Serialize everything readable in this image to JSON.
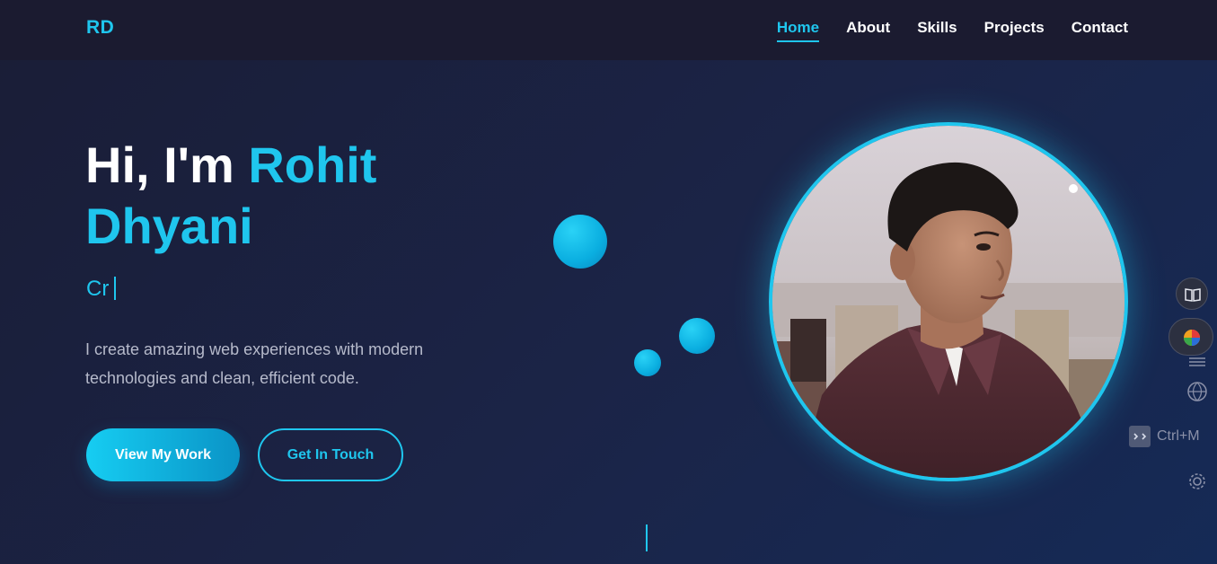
{
  "nav": {
    "logo": "RD",
    "links": [
      "Home",
      "About",
      "Skills",
      "Projects",
      "Contact"
    ],
    "active": "Home"
  },
  "hero": {
    "greeting": "Hi, I'm",
    "first_name": "Rohit",
    "last_name": "Dhyani",
    "typed_text": "Cr",
    "description": "I create amazing web experiences with modern technologies and clean, efficient code.",
    "primary_button": "View My Work",
    "secondary_button": "Get In Touch"
  },
  "sidebar": {
    "shortcut_label": "Ctrl+M",
    "icons": [
      "book-icon",
      "color-wheel-icon",
      "list-icon",
      "www-globe-icon",
      "terminal-icon",
      "gear-icon"
    ]
  },
  "colors": {
    "accent": "#1fc6ee",
    "navbar": "#1b1b30",
    "background": "#1b2447",
    "text_muted": "#b6bacb"
  }
}
